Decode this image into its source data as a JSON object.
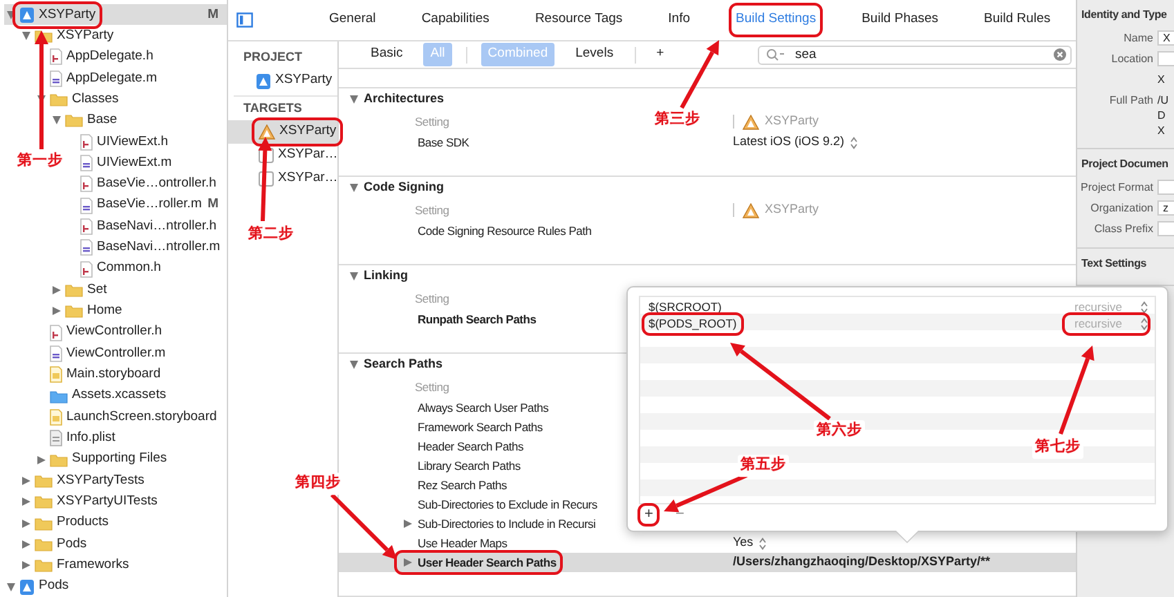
{
  "navigator": {
    "items": [
      {
        "name": "XSYParty",
        "kind": "project",
        "expanded": true,
        "selected": true,
        "boxed": true,
        "badge": "M",
        "children": [
          {
            "name": "XSYParty",
            "kind": "folder",
            "expanded": true,
            "selected": false,
            "boxed": false,
            "children": [
              {
                "name": "AppDelegate.h",
                "kind": "header",
                "selected": false,
                "boxed": false
              },
              {
                "name": "AppDelegate.m",
                "kind": "source",
                "selected": false,
                "boxed": false
              },
              {
                "name": "Classes",
                "kind": "folder",
                "expanded": true,
                "selected": false,
                "boxed": false,
                "children": [
                  {
                    "name": "Base",
                    "kind": "folder",
                    "expanded": true,
                    "selected": false,
                    "boxed": false,
                    "children": [
                      {
                        "name": "UIViewExt.h",
                        "kind": "header",
                        "selected": false,
                        "boxed": false
                      },
                      {
                        "name": "UIViewExt.m",
                        "kind": "source",
                        "selected": false,
                        "boxed": false
                      },
                      {
                        "name": "BaseVie…ontroller.h",
                        "kind": "header",
                        "selected": false,
                        "boxed": false
                      },
                      {
                        "name": "BaseVie…roller.m",
                        "kind": "source",
                        "selected": false,
                        "boxed": false,
                        "badge": "M"
                      },
                      {
                        "name": "BaseNavi…ntroller.h",
                        "kind": "header",
                        "selected": false,
                        "boxed": false
                      },
                      {
                        "name": "BaseNavi…ntroller.m",
                        "kind": "source",
                        "selected": false,
                        "boxed": false
                      },
                      {
                        "name": "Common.h",
                        "kind": "header",
                        "selected": false,
                        "boxed": false
                      }
                    ]
                  },
                  {
                    "name": "Set",
                    "kind": "folder",
                    "expanded": false,
                    "selected": false,
                    "boxed": false
                  },
                  {
                    "name": "Home",
                    "kind": "folder",
                    "expanded": false,
                    "selected": false,
                    "boxed": false
                  }
                ]
              },
              {
                "name": "ViewController.h",
                "kind": "header",
                "selected": false,
                "boxed": false
              },
              {
                "name": "ViewController.m",
                "kind": "source",
                "selected": false,
                "boxed": false
              },
              {
                "name": "Main.storyboard",
                "kind": "storyboard",
                "selected": false,
                "boxed": false
              },
              {
                "name": "Assets.xcassets",
                "kind": "assets",
                "selected": false,
                "boxed": false
              },
              {
                "name": "LaunchScreen.storyboard",
                "kind": "storyboard",
                "selected": false,
                "boxed": false
              },
              {
                "name": "Info.plist",
                "kind": "plist",
                "selected": false,
                "boxed": false
              },
              {
                "name": "Supporting Files",
                "kind": "folder",
                "expanded": false,
                "selected": false,
                "boxed": false
              }
            ]
          },
          {
            "name": "XSYPartyTests",
            "kind": "folder",
            "expanded": false,
            "selected": false,
            "boxed": false
          },
          {
            "name": "XSYPartyUITests",
            "kind": "folder",
            "expanded": false,
            "selected": false,
            "boxed": false
          },
          {
            "name": "Products",
            "kind": "folder",
            "expanded": false,
            "selected": false,
            "boxed": false
          },
          {
            "name": "Pods",
            "kind": "folder",
            "expanded": false,
            "selected": false,
            "boxed": false
          },
          {
            "name": "Frameworks",
            "kind": "folder",
            "expanded": false,
            "selected": false,
            "boxed": false
          }
        ]
      },
      {
        "name": "Pods",
        "kind": "project",
        "expanded": true,
        "selected": false,
        "boxed": false
      }
    ]
  },
  "editor": {
    "tabs": [
      {
        "label": "General",
        "selected": false,
        "boxed": false
      },
      {
        "label": "Capabilities",
        "selected": false,
        "boxed": false
      },
      {
        "label": "Resource Tags",
        "selected": false,
        "boxed": false
      },
      {
        "label": "Info",
        "selected": false,
        "boxed": false
      },
      {
        "label": "Build Settings",
        "selected": true,
        "boxed": true
      },
      {
        "label": "Build Phases",
        "selected": false,
        "boxed": false
      },
      {
        "label": "Build Rules",
        "selected": false,
        "boxed": false
      }
    ],
    "targets_pane": {
      "project_header": "PROJECT",
      "projects": [
        {
          "name": "XSYParty",
          "selected": false
        }
      ],
      "targets_header": "TARGETS",
      "targets": [
        {
          "name": "XSYParty",
          "kind": "app",
          "selected": true,
          "boxed": true
        },
        {
          "name": "XSYPar…",
          "kind": "test",
          "selected": false,
          "boxed": false
        },
        {
          "name": "XSYPar…",
          "kind": "test",
          "selected": false,
          "boxed": false
        }
      ]
    },
    "filter_bar": {
      "scopes": [
        {
          "label": "Basic",
          "selected": false
        },
        {
          "label": "All",
          "selected": true
        }
      ],
      "views": [
        {
          "label": "Combined",
          "selected": true
        },
        {
          "label": "Levels",
          "selected": false
        }
      ],
      "add_label": "+",
      "search": {
        "value": "sea"
      }
    },
    "sections": [
      {
        "title": "Architectures",
        "expanded": true,
        "setting_header": "Setting",
        "target_header": "XSYParty",
        "rows": [
          {
            "label": "Base SDK",
            "value": "Latest iOS (iOS 9.2)",
            "popup": true,
            "bold": false,
            "selected": false,
            "boxed": false
          }
        ]
      },
      {
        "title": "Code Signing",
        "expanded": true,
        "setting_header": "Setting",
        "target_header": "XSYParty",
        "rows": [
          {
            "label": "Code Signing Resource Rules Path",
            "bold": false,
            "selected": false,
            "boxed": false
          }
        ]
      },
      {
        "title": "Linking",
        "expanded": true,
        "setting_header": "Setting",
        "rows": [
          {
            "label": "Runpath Search Paths",
            "bold": true,
            "selected": false,
            "boxed": false
          }
        ]
      },
      {
        "title": "Search Paths",
        "expanded": true,
        "setting_header": "Setting",
        "rows": [
          {
            "label": "Always Search User Paths",
            "bold": false,
            "selected": false,
            "boxed": false
          },
          {
            "label": "Framework Search Paths",
            "bold": false,
            "selected": false,
            "boxed": false
          },
          {
            "label": "Header Search Paths",
            "bold": false,
            "selected": false,
            "boxed": false
          },
          {
            "label": "Library Search Paths",
            "bold": false,
            "selected": false,
            "boxed": false
          },
          {
            "label": "Rez Search Paths",
            "bold": false,
            "selected": false,
            "boxed": false
          },
          {
            "label": "Sub-Directories to Exclude in Recurs",
            "bold": false,
            "selected": false,
            "boxed": false
          },
          {
            "label": "Sub-Directories to Include in Recursi",
            "expanded": false,
            "bold": false,
            "selected": false,
            "boxed": false
          },
          {
            "label": "Use Header Maps",
            "value": "Yes",
            "popup": true,
            "bold": false,
            "selected": false,
            "boxed": false
          },
          {
            "label": "User Header Search Paths",
            "value": "/Users/zhangzhaoqing/Desktop/XSYParty/**",
            "expanded": false,
            "bold": true,
            "selected": true,
            "boxed": true
          }
        ]
      }
    ]
  },
  "path_editor": {
    "entries": [
      {
        "path": "$(SRCROOT)",
        "mode": "recursive",
        "path_boxed": false,
        "mode_boxed": false
      },
      {
        "path": "$(PODS_ROOT)",
        "mode": "recursive",
        "path_boxed": true,
        "mode_boxed": true
      }
    ],
    "add_button": {
      "label": "+",
      "boxed": true
    },
    "remove_button": {
      "label": "−",
      "disabled": true
    }
  },
  "inspector": {
    "sections": [
      {
        "title": "Identity and Type",
        "fields": [
          {
            "label": "Name",
            "kind": "field",
            "value": "X"
          },
          {
            "label": "Location",
            "kind": "field",
            "lines": [
              "X"
            ]
          },
          {
            "label": "Full Path",
            "kind": "text",
            "lines": [
              "/U",
              "D",
              "X"
            ]
          }
        ]
      },
      {
        "title": "Project Documen",
        "fields": [
          {
            "label": "Project Format",
            "kind": "field"
          },
          {
            "label": "Organization",
            "kind": "field",
            "value": "z"
          },
          {
            "label": "Class Prefix",
            "kind": "field"
          }
        ]
      },
      {
        "title": "Text Settings"
      }
    ]
  },
  "annotations": [
    {
      "label": "第一步"
    },
    {
      "label": "第二步"
    },
    {
      "label": "第三步"
    },
    {
      "label": "第四步"
    },
    {
      "label": "第五步"
    },
    {
      "label": "第六步"
    },
    {
      "label": "第七步"
    }
  ]
}
